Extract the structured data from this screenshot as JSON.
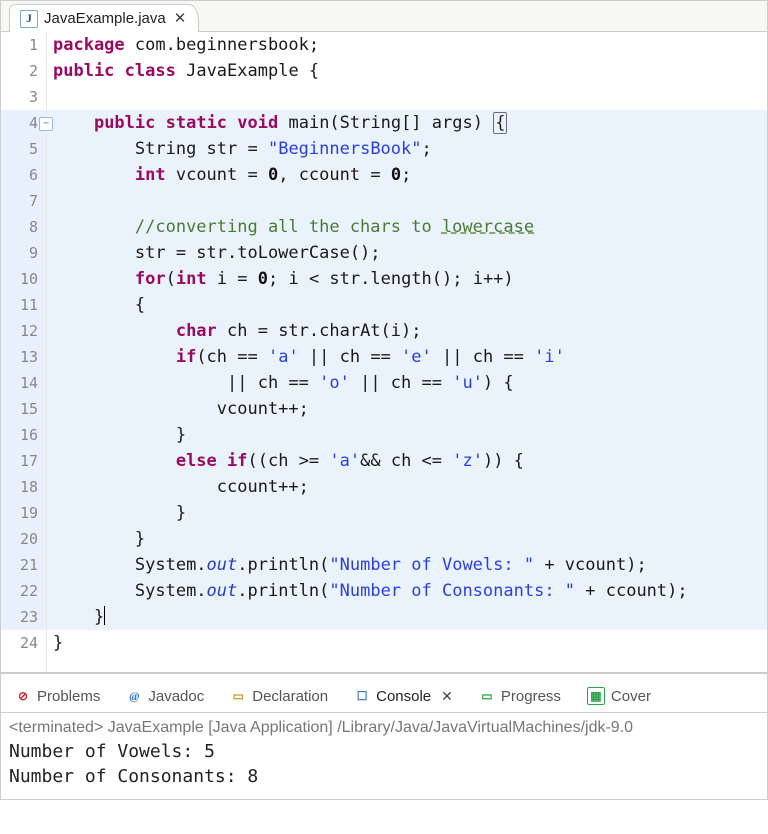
{
  "editor_tab": {
    "filename": "JavaExample.java",
    "close_glyph": "✕"
  },
  "gutter": {
    "lines": [
      "1",
      "2",
      "3",
      "4",
      "5",
      "6",
      "7",
      "8",
      "9",
      "10",
      "11",
      "12",
      "13",
      "14",
      "15",
      "16",
      "17",
      "18",
      "19",
      "20",
      "21",
      "22",
      "23",
      "24"
    ],
    "fold_at": 4,
    "highlight_from": 4,
    "highlight_to": 23
  },
  "code": {
    "pkg_kw": "package",
    "pkg_name": " com.beginnersbook;",
    "pub": "public",
    "cls_kw": "class",
    "cls_name": " JavaExample {",
    "static": "static",
    "void": "void",
    "main": " main(String[] args) ",
    "str_decl_type": "String",
    "str_decl_rest": " str = ",
    "str_lit": "\"BeginnersBook\"",
    "semicolon": ";",
    "int_kw": "int",
    "counts_rest": " vcount = ",
    "zero": "0",
    "counts_rest2": ", ccount = ",
    "comment1a": "//converting all the chars to ",
    "comment1b": "lowercase",
    "l9": "str = str.toLowerCase();",
    "for_kw": "for",
    "for_rest": "(",
    "for_rest2": " i = ",
    "for_rest3": "; i < str.length(); i++)",
    "l11": "{",
    "char_kw": "char",
    "l12_rest": " ch = str.charAt(i);",
    "if_kw": "if",
    "l13_rest": "(ch == ",
    "ch_a": "'a'",
    "or": " || ch == ",
    "ch_e": "'e'",
    "ch_i": "'i'",
    "ch_o": "'o'",
    "ch_u": "'u'",
    "l14_end": ") {",
    "l15": "vcount++;",
    "l16": "}",
    "else_kw": "else",
    "l17_rest1": "((ch >= ",
    "l17_and": "&& ch <= ",
    "ch_z": "'z'",
    "l17_end": ")) {",
    "l18": "ccount++;",
    "l19": "}",
    "l20": "}",
    "sys": "System.",
    "out": "out",
    "println": ".println(",
    "vow_str": "\"Number of Vowels: \"",
    "vow_end": " + vcount);",
    "con_str": "\"Number of Consonants: \"",
    "con_end": " + ccount);",
    "l23": "}",
    "l24": "}",
    "open_brace": "{"
  },
  "views": {
    "problems": "Problems",
    "javadoc": "Javadoc",
    "declaration": "Declaration",
    "console": "Console",
    "progress": "Progress",
    "coverage": "Cover"
  },
  "console": {
    "status": "<terminated> JavaExample [Java Application] /Library/Java/JavaVirtualMachines/jdk-9.0",
    "line1": "Number of Vowels: 5",
    "line2": "Number of Consonants: 8"
  }
}
